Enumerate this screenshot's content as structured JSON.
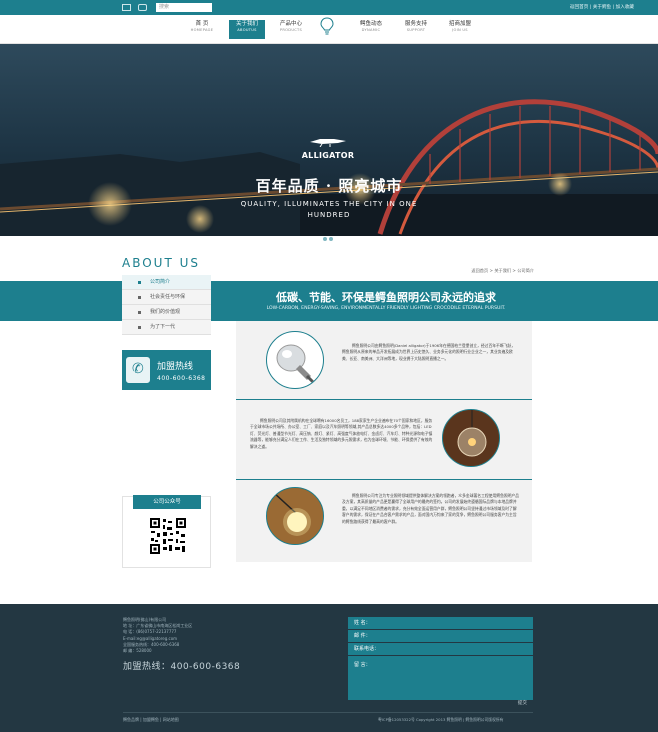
{
  "topbar": {
    "search_placeholder": "搜索",
    "links": "返回首页 | 关于鳄鱼 | 加入收藏"
  },
  "nav": {
    "items": [
      {
        "cn": "首 页",
        "en": "HOMEPAGE"
      },
      {
        "cn": "关于我们",
        "en": "ABOUTUS"
      },
      {
        "cn": "产品中心",
        "en": "PRODUCTS"
      },
      {
        "cn": "鳄鱼动态",
        "en": "DYNAMIC"
      },
      {
        "cn": "服务支持",
        "en": "SUPPORT"
      },
      {
        "cn": "招商加盟",
        "en": "JOIN US"
      }
    ]
  },
  "banner": {
    "logo": "ALLIGATOR",
    "headline": "百年品质 · 照亮城市",
    "subline": "QUALITY, ILLUMINATES THE CITY IN ONE HUNDRED"
  },
  "about": {
    "title": "ABOUT  US",
    "breadcrumb": "返回首页 > 关于我们 > 公司简介"
  },
  "side": {
    "items": [
      "公司简介",
      "社会责任与环保",
      "我们的价值观",
      "为了下一代"
    ],
    "hotline_title": "加盟热线",
    "hotline_number": "400-600-6368",
    "wechat_title": "公司公众号"
  },
  "strip": {
    "cn": "低碳、节能、环保是鳄鱼照明公司永远的追求",
    "en": "LOW-CARBON, ENERGY-SAVING, ENVIRONMENTALLY FRIENDLY LIGHTING CROCODILE ETERNAL PURSUIT."
  },
  "content": {
    "p1": "鳄鱼照明公司由鳄鱼照明(Daniel alligator)于1906年在德国柏兰登堡创立，经过百年不断飞跃，鳄鱼照明从原来的单品开发拓展成为世界上历史悠久、业务多元化的照明行业企业之一，其业务遍及欧美、长亚、南美洲、大洋洲等地，现业拥于大陆照明直播之一。",
    "p2": "鳄鱼照明公司及其附属机构在全球聘有16000名员工，188家家生产企业遍布在70个国家和地区，服务于全球市场公共场所、办公室、工厂、家庭以及汽车照明等领域,其产品总数多达4000多个品种，包括：LED灯、荧光灯、普通型节光灯、高压钠、颜灯、紧灯、高强度气体放电灯、金卤灯、汽车灯、特种光源和电子镇流器等，能够充分满足人们在工作、生活及独特领域的多元照需求，也为金球环境、节能、环保提供了有效的解决之道。",
    "p3": "鳄鱼照明公司专注为专业照明领域提供整体解决方案的领跑者，众多金球著名工程使用鳄鱼照明产品及方案，其高质量的产品更是赢得了全球用户的最终的签约。公司的发展始终遵循国际品牌与本地品牌并重，以满足不同地区消费者的需求，充分有效全面运营用户群，鳄鱼照明公司坚持通过市场领域及时了解客户的需求，保证在产品合客户需求的产品，面对国内万钧来了家的竞争，鳄鱼照明公司服务客户为主旨的鳄鱼路线获得了最高的客户群。"
  },
  "footer": {
    "company": "鳄鱼照明(佛山)有限公司",
    "address": "地 址：广东省佛山市南海区松岗工业区",
    "phone": "电 话：(86)0757-22137777",
    "email": "E-mail:eg@alligatoreg.com",
    "qq": "全国服务热线：400-600-6368",
    "fax": "邮 编：528000",
    "hotline": "加盟热线：400-600-6368",
    "form_fields": [
      "姓  名：",
      "邮  件：",
      "联系电话：",
      "留  言："
    ],
    "submit": "提交",
    "bottom_left": "鳄鱼品牌 | 加盟鳄鱼 | 网站地图",
    "bottom_right": "粤ICP备12053322号 Copyright 2013 鳄鱼照明 | 鳄鱼照明公司版权所有"
  },
  "colors": {
    "brand": "#1d7f8e",
    "footer": "#233742"
  }
}
